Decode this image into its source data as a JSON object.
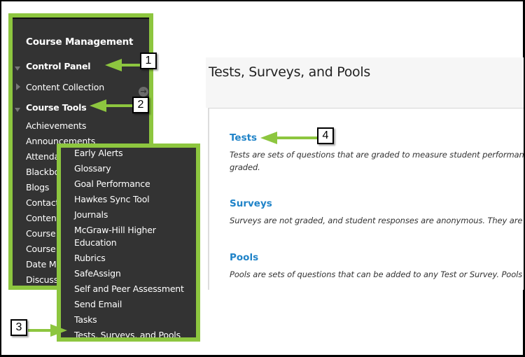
{
  "sidebar": {
    "title": "Course Management",
    "items": [
      {
        "label": "Control Panel",
        "bold": true,
        "expander": "expanded"
      },
      {
        "label": "Content Collection",
        "bold": false,
        "expander": "collapsed"
      },
      {
        "label": "Course Tools",
        "bold": true,
        "expander": "expanded"
      },
      {
        "label": "Achievements"
      },
      {
        "label": "Announcements"
      },
      {
        "label": "Attendance"
      },
      {
        "label": "Blackboard"
      },
      {
        "label": "Blogs"
      },
      {
        "label": "Contacts"
      },
      {
        "label": "Content"
      },
      {
        "label": "Course"
      },
      {
        "label": "Course"
      },
      {
        "label": "Date Management"
      },
      {
        "label": "Discussions"
      }
    ],
    "content_collection_icon": "circle-arrow-right-icon"
  },
  "submenu": {
    "items": [
      "Early Alerts",
      "Glossary",
      "Goal Performance",
      "Hawkes Sync Tool",
      "Journals",
      "McGraw-Hill Higher",
      "Education",
      "Rubrics",
      "SafeAssign",
      "Self and Peer Assessment",
      "Send Email",
      "Tasks",
      "Tests, Surveys, and Pools"
    ]
  },
  "main": {
    "title": "Tests, Surveys, and Pools",
    "sections": [
      {
        "link": "Tests",
        "desc": "Tests are sets of questions that are graded to measure student performance",
        "desc2": "graded."
      },
      {
        "link": "Surveys",
        "desc": "Surveys are not graded, and student responses are anonymous. They are u"
      },
      {
        "link": "Pools",
        "desc": "Pools are sets of questions that can be added to any Test or Survey. Pools c"
      }
    ]
  },
  "callouts": [
    "1",
    "2",
    "3",
    "4"
  ],
  "colors": {
    "highlight_green": "#8dc63f",
    "menu_bg": "#333333",
    "link_blue": "#1f83c8"
  }
}
